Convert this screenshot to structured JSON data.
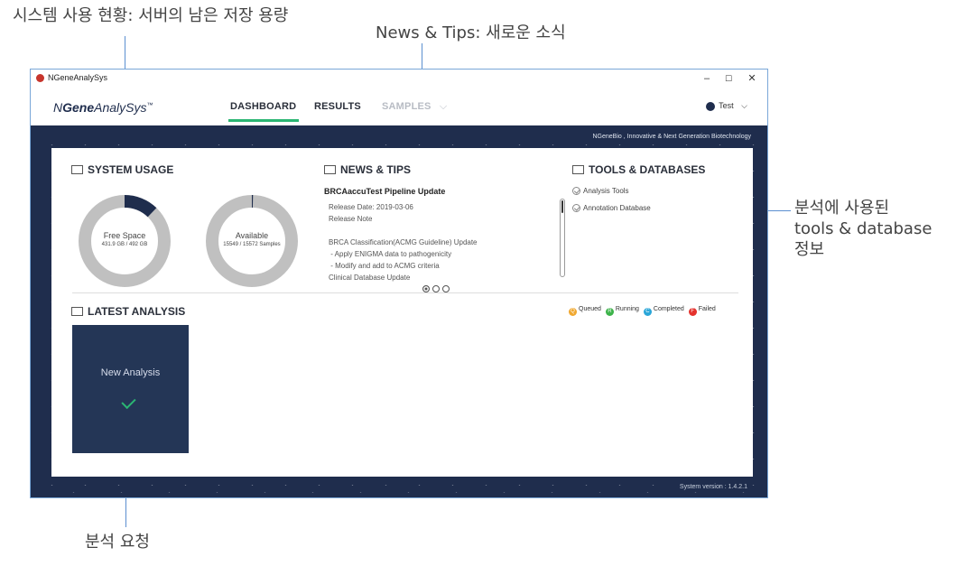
{
  "annotations": {
    "system_usage": "시스템 사용 현황: 서버의 남은 저장 용량",
    "news_tips": "News & Tips: 새로운 소식",
    "tools_db": [
      "분석에 사용된",
      "tools & database",
      "정보"
    ],
    "request": "분석 요청"
  },
  "window": {
    "title": "NGeneAnalySys",
    "controls": {
      "minimize": "–",
      "maximize": "☐",
      "close": "✕"
    }
  },
  "nav": {
    "brand_prefix": "N",
    "brand_bold": "Gene",
    "brand_suffix": "AnalySys",
    "brand_tm": "™",
    "tabs": [
      {
        "label": "DASHBOARD",
        "active": true
      },
      {
        "label": "RESULTS"
      },
      {
        "label": "SAMPLES",
        "disabled": true
      }
    ],
    "dropdown_glyph": "⌵",
    "user": "Test",
    "user_caret": "⌵"
  },
  "tagline": "NGeneBio , Innovative & Next Generation Biotechnology",
  "system_version": "System version : 1.4.2.1",
  "system_usage": {
    "title": "SYSTEM USAGE",
    "free_space": {
      "label": "Free Space",
      "value": "431.9 GB / 492 GB",
      "free_fraction": 0.878
    },
    "available": {
      "label": "Available",
      "value": "15549 / 15572 Samples",
      "available_fraction": 0.9985
    }
  },
  "news": {
    "title": "NEWS & TIPS",
    "headline": "BRCAaccuTest Pipeline Update",
    "lines": [
      "Release Date: 2019-03-06",
      "Release Note",
      "",
      "BRCA Classification(ACMG Guideline) Update",
      " - Apply ENIGMA data to pathogenicity",
      " - Modify and add to ACMG criteria",
      "Clinical Database Update"
    ],
    "pages": 3,
    "current_page": 1
  },
  "tools": {
    "title": "TOOLS & DATABASES",
    "items": [
      "Analysis Tools",
      "Annotation Database"
    ]
  },
  "latest": {
    "title": "LATEST ANALYSIS",
    "new_analysis": "New Analysis",
    "legend": [
      {
        "letter": "Q",
        "label": "Queued",
        "color": "#f0a830"
      },
      {
        "letter": "R",
        "label": "Running",
        "color": "#3db34a"
      },
      {
        "letter": "C",
        "label": "Completed",
        "color": "#2aa6d8"
      },
      {
        "letter": "F",
        "label": "Failed",
        "color": "#e5322d"
      }
    ]
  },
  "colors": {
    "navy": "#1f2d4d",
    "accent_green": "#2bb673",
    "donut_gray": "#c0c0c0",
    "callout_line": "#5b8fd0"
  }
}
